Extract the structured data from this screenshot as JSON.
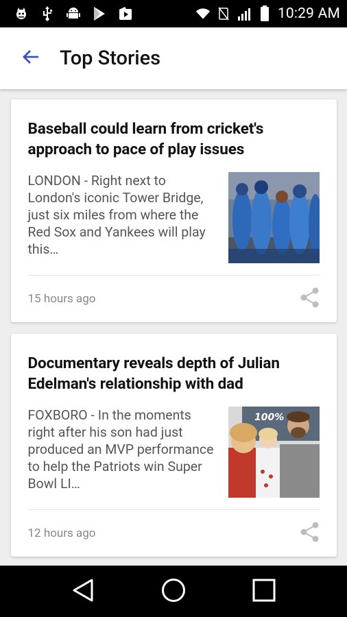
{
  "status_bar": {
    "time": "10:29 AM",
    "left_icons": [
      "cat-icon",
      "usb-icon",
      "android-icon",
      "play-store-icon",
      "play-movies-icon"
    ],
    "right_icons": [
      "wifi-icon",
      "no-sim-icon",
      "signal-icon",
      "battery-icon"
    ]
  },
  "app_bar": {
    "title": "Top Stories",
    "back_icon": "arrow-back-icon",
    "accent": "#3f51b5"
  },
  "articles": [
    {
      "title": "Baseball could learn from cricket's approach to pace of play issues",
      "summary": "LONDON - Right next to London's iconic Tower Bridge, just six miles from where the Red Sox and Yankees will play this…",
      "time": "15 hours ago",
      "thumbnail": "cricket-team-photo"
    },
    {
      "title": "Documentary reveals depth of Julian Edelman's relationship with dad",
      "summary": "FOXBORO - In the moments right after his son had just produced an MVP performance to help the Patriots win Super Bowl LI…",
      "time": "12 hours ago",
      "thumbnail": "edelman-family-photo"
    }
  ],
  "nav_bar": {
    "buttons": [
      "back-triangle-icon",
      "home-circle-icon",
      "recents-square-icon"
    ]
  }
}
